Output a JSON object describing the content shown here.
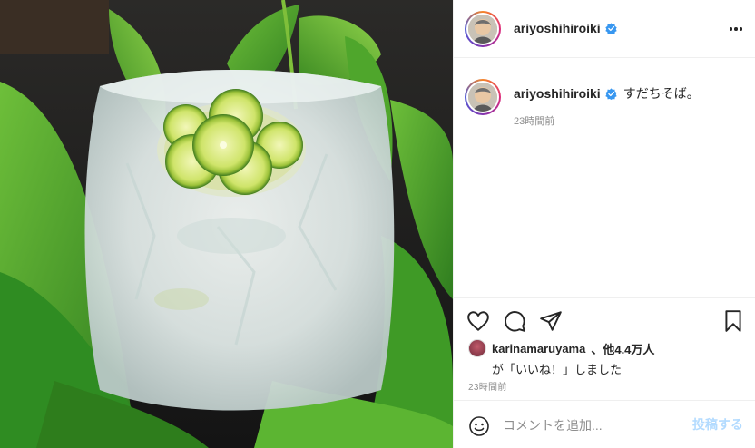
{
  "post": {
    "username": "ariyoshihiroiki",
    "verified": true,
    "caption_text": "すだちそば。",
    "caption_time": "23時間前",
    "post_time": "23時間前"
  },
  "likes": {
    "first_liker": "karinamaruyama",
    "others": "、他4.4万人",
    "suffix": "が「いいね！」しました"
  },
  "comment": {
    "placeholder": "コメントを追加...",
    "post_label": "投稿する"
  },
  "icons": {
    "more": "more-options-icon",
    "like": "heart-icon",
    "comment": "comment-icon",
    "share": "paper-plane-icon",
    "save": "bookmark-icon",
    "emoji": "smiley-icon",
    "verified": "verified-badge-icon"
  },
  "colors": {
    "verified_blue": "#3897f0",
    "post_button_disabled": "#b3dbff",
    "secondary_text": "#8e8e8e",
    "divider": "#efefef"
  }
}
